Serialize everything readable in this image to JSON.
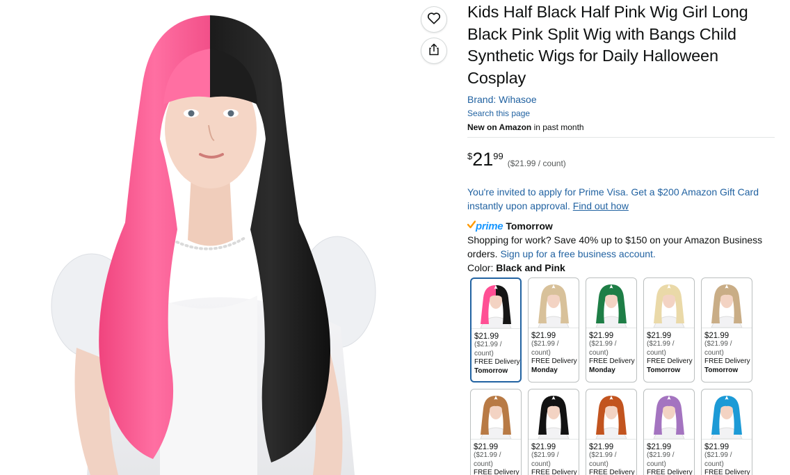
{
  "product": {
    "title": "Kids Half Black Half Pink Wig Girl Long Black Pink Split Wig with Bangs Child Synthetic Wigs for Daily Halloween Cosplay",
    "brand": "Brand: Wihasoe",
    "search_page": "Search this page",
    "new_bold": "New on Amazon",
    "new_rest": " in past month"
  },
  "price": {
    "currency": "$",
    "whole": "21",
    "fraction": "99",
    "per_unit": "($21.99 / count)"
  },
  "promo": {
    "text": "You're invited to apply for Prime Visa. Get a $200 Amazon Gift Card instantly upon approval. ",
    "link": "Find out how"
  },
  "prime": {
    "logo": "prime",
    "delivery": "Tomorrow"
  },
  "business": {
    "text": "Shopping for work? Save 40% up to $150 on your Amazon Business orders. ",
    "link": "Sign up for a free business account."
  },
  "color": {
    "label": "Color: ",
    "value": "Black and Pink"
  },
  "swatches": [
    {
      "name": "black-pink",
      "price": "$21.99",
      "unit1": "($21.99 /",
      "unit2": "count)",
      "free": "FREE Delivery",
      "day": "Tomorrow",
      "hair": "#ff4f94",
      "hair2": "#151515",
      "selected": true
    },
    {
      "name": "blonde-bangs",
      "price": "$21.99",
      "unit1": "($21.99 /",
      "unit2": "count)",
      "free": "FREE Delivery",
      "day": "Monday",
      "hair": "#d8c19a",
      "hair2": "#d8c19a",
      "selected": false
    },
    {
      "name": "green",
      "price": "$21.99",
      "unit1": "($21.99 /",
      "unit2": "count)",
      "free": "FREE Delivery",
      "day": "Monday",
      "hair": "#1e7e46",
      "hair2": "#1e7e46",
      "selected": false
    },
    {
      "name": "light-blonde",
      "price": "$21.99",
      "unit1": "($21.99 /",
      "unit2": "count)",
      "free": "FREE Delivery",
      "day": "Tomorrow",
      "hair": "#ead9a8",
      "hair2": "#ead9a8",
      "selected": false
    },
    {
      "name": "ash-blonde",
      "price": "$21.99",
      "unit1": "($21.99 /",
      "unit2": "count)",
      "free": "FREE Delivery",
      "day": "Tomorrow",
      "hair": "#c9ad86",
      "hair2": "#c9ad86",
      "selected": false
    },
    {
      "name": "light-brown",
      "price": "$21.99",
      "unit1": "($21.99 /",
      "unit2": "count)",
      "free": "FREE Delivery",
      "day": "",
      "hair": "#b87a45",
      "hair2": "#b87a45",
      "selected": false
    },
    {
      "name": "black",
      "price": "$21.99",
      "unit1": "($21.99 /",
      "unit2": "count)",
      "free": "FREE Delivery",
      "day": "",
      "hair": "#121212",
      "hair2": "#121212",
      "selected": false
    },
    {
      "name": "copper",
      "price": "$21.99",
      "unit1": "($21.99 /",
      "unit2": "count)",
      "free": "FREE Delivery",
      "day": "",
      "hair": "#c2541f",
      "hair2": "#c2541f",
      "selected": false
    },
    {
      "name": "purple",
      "price": "$21.99",
      "unit1": "($21.99 /",
      "unit2": "count)",
      "free": "FREE Delivery",
      "day": "",
      "hair": "#a474c0",
      "hair2": "#a474c0",
      "selected": false
    },
    {
      "name": "blue",
      "price": "$21.99",
      "unit1": "($21.99 /",
      "unit2": "count)",
      "free": "FREE Delivery",
      "day": "",
      "hair": "#1c9ad6",
      "hair2": "#1c9ad6",
      "selected": false
    }
  ],
  "icons": {
    "wishlist": "heart-icon",
    "share": "share-icon"
  },
  "colors": {
    "link": "#2162a1",
    "text": "#0f1111",
    "prime": "#1a98ff",
    "prime_check": "#ff9900",
    "selected_border": "#2162a1"
  }
}
